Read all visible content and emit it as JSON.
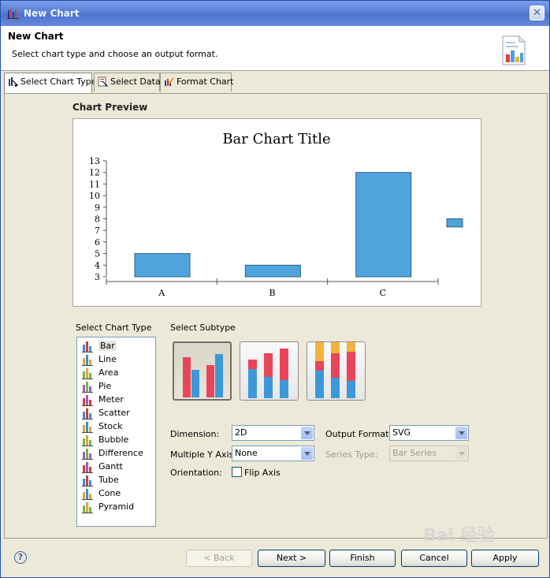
{
  "window": {
    "title": "New Chart",
    "close_label": "✕"
  },
  "header": {
    "title": "New Chart",
    "subtitle": "Select chart type and choose an output format."
  },
  "tabs": [
    {
      "label": "Select Chart Type",
      "active": true
    },
    {
      "label": "Select Data",
      "active": false
    },
    {
      "label": "Format Chart",
      "active": false
    }
  ],
  "preview": {
    "label": "Chart Preview"
  },
  "chart_data": {
    "type": "bar",
    "title": "Bar Chart Title",
    "categories": [
      "A",
      "B",
      "C"
    ],
    "series": [
      {
        "values": [
          5,
          4,
          12
        ]
      }
    ],
    "extra_mark_values": [
      7.3,
      8
    ],
    "ylim": [
      3,
      13
    ],
    "yticks": [
      "3",
      "4",
      "5",
      "6",
      "7",
      "8",
      "9",
      "10",
      "11",
      "12",
      "13"
    ],
    "bar_color": "#4ea4dc",
    "grid": false,
    "legend": "none"
  },
  "chart_type": {
    "label": "Select Chart Type",
    "items": [
      {
        "label": "Bar",
        "icon": "bar-chart-icon",
        "selected": true
      },
      {
        "label": "Line",
        "icon": "line-chart-icon"
      },
      {
        "label": "Area",
        "icon": "area-chart-icon"
      },
      {
        "label": "Pie",
        "icon": "pie-chart-icon"
      },
      {
        "label": "Meter",
        "icon": "meter-chart-icon"
      },
      {
        "label": "Scatter",
        "icon": "scatter-chart-icon"
      },
      {
        "label": "Stock",
        "icon": "stock-chart-icon"
      },
      {
        "label": "Bubble",
        "icon": "bubble-chart-icon"
      },
      {
        "label": "Difference",
        "icon": "difference-chart-icon"
      },
      {
        "label": "Gantt",
        "icon": "gantt-chart-icon"
      },
      {
        "label": "Tube",
        "icon": "tube-chart-icon"
      },
      {
        "label": "Cone",
        "icon": "cone-chart-icon"
      },
      {
        "label": "Pyramid",
        "icon": "pyramid-chart-icon"
      }
    ]
  },
  "subtype": {
    "label": "Select Subtype",
    "options": [
      "side-by-side",
      "stacked",
      "percent-stacked"
    ],
    "selected": 0
  },
  "options": {
    "dimension_label": "Dimension:",
    "dimension_value": "2D",
    "multi_y_label": "Multiple Y Axis:",
    "multi_y_value": "None",
    "orientation_label": "Orientation:",
    "flip_axis_label": "Flip Axis",
    "flip_axis_checked": false,
    "output_format_label": "Output Format:",
    "output_format_value": "SVG",
    "series_type_label": "Series Type:",
    "series_type_value": "Bar Series"
  },
  "buttons": {
    "back": "< Back",
    "next": "Next >",
    "finish": "Finish",
    "cancel": "Cancel",
    "apply": "Apply"
  },
  "watermark": "Bai 经验"
}
